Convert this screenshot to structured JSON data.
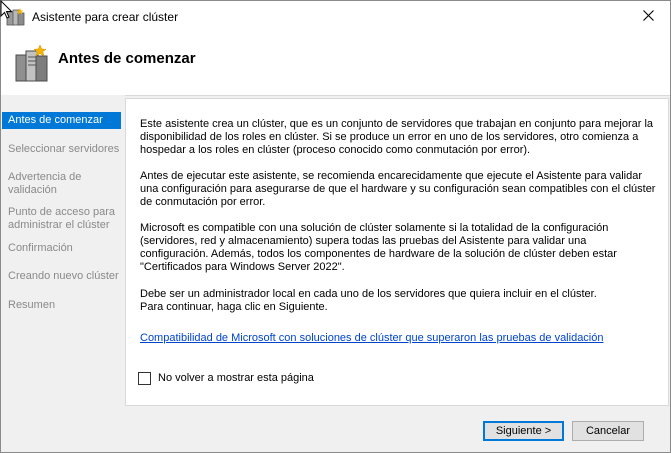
{
  "window": {
    "title": "Asistente para crear clúster"
  },
  "header": {
    "title": "Antes de comenzar"
  },
  "sidebar": {
    "items": [
      {
        "label": "Antes de comenzar"
      },
      {
        "label": "Seleccionar servidores"
      },
      {
        "label": "Advertencia de\nvalidación"
      },
      {
        "label": "Punto de acceso para\nadministrar el clúster"
      },
      {
        "label": "Confirmación"
      },
      {
        "label": "Creando nuevo clúster"
      },
      {
        "label": "Resumen"
      }
    ]
  },
  "content": {
    "paragraphs": [
      "Este asistente crea un clúster, que es un conjunto de servidores que trabajan en conjunto para mejorar la disponibilidad de los roles en clúster. Si se produce un error en uno de los servidores, otro comienza a hospedar a los roles en clúster (proceso conocido como conmutación por error).",
      "Antes de ejecutar este asistente, se recomienda encarecidamente que ejecute el Asistente para validar una configuración para asegurarse de que el hardware y su configuración sean compatibles con el clúster de conmutación por error.",
      "Microsoft es compatible con una solución de clúster solamente si la totalidad de la configuración (servidores, red y almacenamiento) supera todas las pruebas del Asistente para validar una configuración. Además, todos los componentes de hardware de la solución de clúster deben estar \"Certificados para Windows Server 2022\".",
      "Debe ser un administrador local en cada uno de los servidores que quiera incluir en el clúster.\nPara continuar, haga clic en Siguiente."
    ],
    "link": "Compatibilidad de Microsoft con soluciones de clúster que superaron las pruebas de validación",
    "checkbox_label": "No volver a mostrar esta página"
  },
  "buttons": {
    "next": "Siguiente >",
    "cancel": "Cancelar"
  },
  "colors": {
    "accent": "#0078d7",
    "link": "#0044cc"
  }
}
